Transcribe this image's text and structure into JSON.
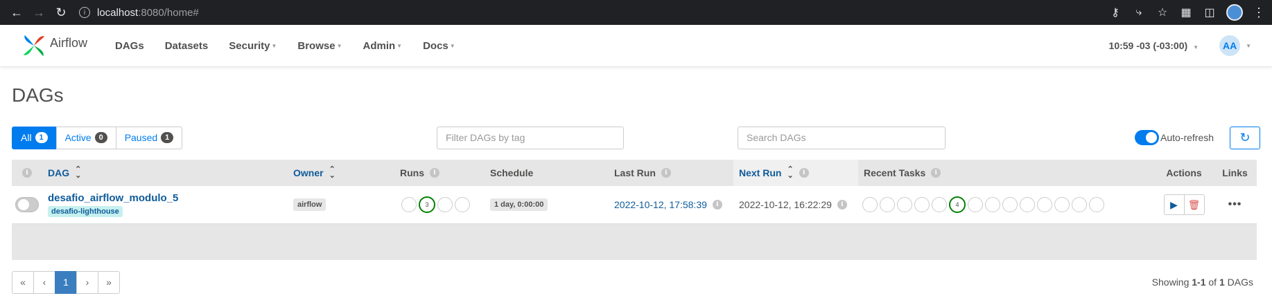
{
  "browser": {
    "url_host": "localhost",
    "url_path": ":8080/home#"
  },
  "navbar": {
    "brand": "Airflow",
    "menu": [
      "DAGs",
      "Datasets",
      "Security",
      "Browse",
      "Admin",
      "Docs"
    ],
    "clock": "10:59 -03 (-03:00)",
    "user_initials": "AA"
  },
  "page": {
    "title": "DAGs"
  },
  "filters": {
    "all_label": "All",
    "all_count": "1",
    "active_label": "Active",
    "active_count": "0",
    "paused_label": "Paused",
    "paused_count": "1",
    "tag_placeholder": "Filter DAGs by tag",
    "search_placeholder": "Search DAGs",
    "autorefresh_label": "Auto-refresh"
  },
  "table": {
    "headers": {
      "dag": "DAG",
      "owner": "Owner",
      "runs": "Runs",
      "schedule": "Schedule",
      "last_run": "Last Run",
      "next_run": "Next Run",
      "recent_tasks": "Recent Tasks",
      "actions": "Actions",
      "links": "Links"
    },
    "rows": [
      {
        "dag_id": "desafio_airflow_modulo_5",
        "tag": "desafio-lighthouse",
        "owner": "airflow",
        "runs_success": "3",
        "schedule": "1 day, 0:00:00",
        "last_run": "2022-10-12, 17:58:39",
        "next_run": "2022-10-12, 16:22:29",
        "tasks_success": "4"
      }
    ]
  },
  "pagination": {
    "first": "«",
    "prev": "‹",
    "current": "1",
    "next": "›",
    "last": "»",
    "showing_prefix": "Showing",
    "showing_range": "1-1",
    "showing_of": "of",
    "showing_total": "1",
    "showing_suffix": "DAGs"
  },
  "colors": {
    "accent": "#017cee",
    "link": "#0f5b9b",
    "success": "#008000",
    "danger": "#d9534f"
  }
}
